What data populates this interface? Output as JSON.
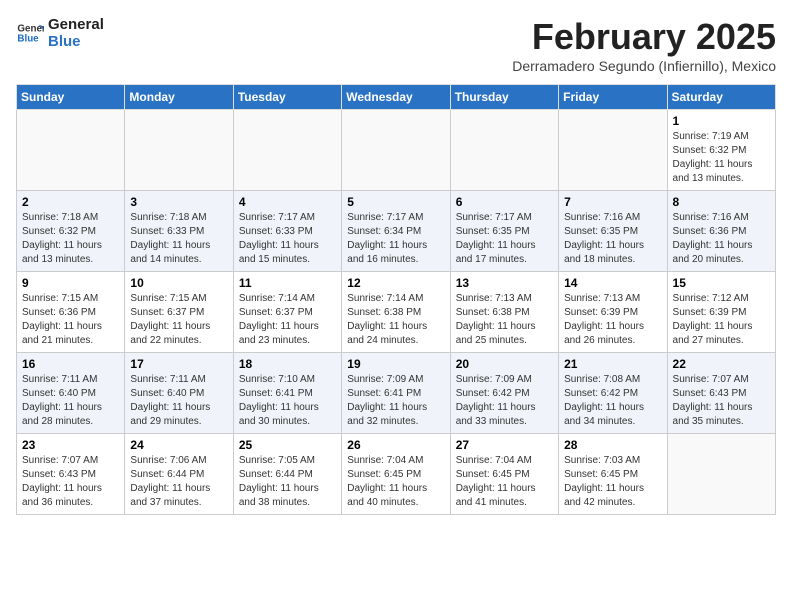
{
  "header": {
    "logo_line1": "General",
    "logo_line2": "Blue",
    "month_title": "February 2025",
    "subtitle": "Derramadero Segundo (Infiernillo), Mexico"
  },
  "weekdays": [
    "Sunday",
    "Monday",
    "Tuesday",
    "Wednesday",
    "Thursday",
    "Friday",
    "Saturday"
  ],
  "weeks": [
    [
      {
        "day": "",
        "info": ""
      },
      {
        "day": "",
        "info": ""
      },
      {
        "day": "",
        "info": ""
      },
      {
        "day": "",
        "info": ""
      },
      {
        "day": "",
        "info": ""
      },
      {
        "day": "",
        "info": ""
      },
      {
        "day": "1",
        "info": "Sunrise: 7:19 AM\nSunset: 6:32 PM\nDaylight: 11 hours\nand 13 minutes."
      }
    ],
    [
      {
        "day": "2",
        "info": "Sunrise: 7:18 AM\nSunset: 6:32 PM\nDaylight: 11 hours\nand 13 minutes."
      },
      {
        "day": "3",
        "info": "Sunrise: 7:18 AM\nSunset: 6:33 PM\nDaylight: 11 hours\nand 14 minutes."
      },
      {
        "day": "4",
        "info": "Sunrise: 7:17 AM\nSunset: 6:33 PM\nDaylight: 11 hours\nand 15 minutes."
      },
      {
        "day": "5",
        "info": "Sunrise: 7:17 AM\nSunset: 6:34 PM\nDaylight: 11 hours\nand 16 minutes."
      },
      {
        "day": "6",
        "info": "Sunrise: 7:17 AM\nSunset: 6:35 PM\nDaylight: 11 hours\nand 17 minutes."
      },
      {
        "day": "7",
        "info": "Sunrise: 7:16 AM\nSunset: 6:35 PM\nDaylight: 11 hours\nand 18 minutes."
      },
      {
        "day": "8",
        "info": "Sunrise: 7:16 AM\nSunset: 6:36 PM\nDaylight: 11 hours\nand 20 minutes."
      }
    ],
    [
      {
        "day": "9",
        "info": "Sunrise: 7:15 AM\nSunset: 6:36 PM\nDaylight: 11 hours\nand 21 minutes."
      },
      {
        "day": "10",
        "info": "Sunrise: 7:15 AM\nSunset: 6:37 PM\nDaylight: 11 hours\nand 22 minutes."
      },
      {
        "day": "11",
        "info": "Sunrise: 7:14 AM\nSunset: 6:37 PM\nDaylight: 11 hours\nand 23 minutes."
      },
      {
        "day": "12",
        "info": "Sunrise: 7:14 AM\nSunset: 6:38 PM\nDaylight: 11 hours\nand 24 minutes."
      },
      {
        "day": "13",
        "info": "Sunrise: 7:13 AM\nSunset: 6:38 PM\nDaylight: 11 hours\nand 25 minutes."
      },
      {
        "day": "14",
        "info": "Sunrise: 7:13 AM\nSunset: 6:39 PM\nDaylight: 11 hours\nand 26 minutes."
      },
      {
        "day": "15",
        "info": "Sunrise: 7:12 AM\nSunset: 6:39 PM\nDaylight: 11 hours\nand 27 minutes."
      }
    ],
    [
      {
        "day": "16",
        "info": "Sunrise: 7:11 AM\nSunset: 6:40 PM\nDaylight: 11 hours\nand 28 minutes."
      },
      {
        "day": "17",
        "info": "Sunrise: 7:11 AM\nSunset: 6:40 PM\nDaylight: 11 hours\nand 29 minutes."
      },
      {
        "day": "18",
        "info": "Sunrise: 7:10 AM\nSunset: 6:41 PM\nDaylight: 11 hours\nand 30 minutes."
      },
      {
        "day": "19",
        "info": "Sunrise: 7:09 AM\nSunset: 6:41 PM\nDaylight: 11 hours\nand 32 minutes."
      },
      {
        "day": "20",
        "info": "Sunrise: 7:09 AM\nSunset: 6:42 PM\nDaylight: 11 hours\nand 33 minutes."
      },
      {
        "day": "21",
        "info": "Sunrise: 7:08 AM\nSunset: 6:42 PM\nDaylight: 11 hours\nand 34 minutes."
      },
      {
        "day": "22",
        "info": "Sunrise: 7:07 AM\nSunset: 6:43 PM\nDaylight: 11 hours\nand 35 minutes."
      }
    ],
    [
      {
        "day": "23",
        "info": "Sunrise: 7:07 AM\nSunset: 6:43 PM\nDaylight: 11 hours\nand 36 minutes."
      },
      {
        "day": "24",
        "info": "Sunrise: 7:06 AM\nSunset: 6:44 PM\nDaylight: 11 hours\nand 37 minutes."
      },
      {
        "day": "25",
        "info": "Sunrise: 7:05 AM\nSunset: 6:44 PM\nDaylight: 11 hours\nand 38 minutes."
      },
      {
        "day": "26",
        "info": "Sunrise: 7:04 AM\nSunset: 6:45 PM\nDaylight: 11 hours\nand 40 minutes."
      },
      {
        "day": "27",
        "info": "Sunrise: 7:04 AM\nSunset: 6:45 PM\nDaylight: 11 hours\nand 41 minutes."
      },
      {
        "day": "28",
        "info": "Sunrise: 7:03 AM\nSunset: 6:45 PM\nDaylight: 11 hours\nand 42 minutes."
      },
      {
        "day": "",
        "info": ""
      }
    ]
  ]
}
